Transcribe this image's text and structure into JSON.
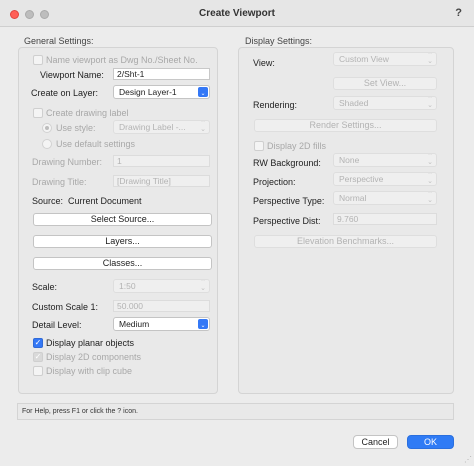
{
  "window": {
    "title": "Create Viewport",
    "help_glyph": "?"
  },
  "general": {
    "section_title": "General Settings:",
    "name_as_dwg_label": "Name viewport as Dwg No./Sheet No.",
    "viewport_name_label": "Viewport Name:",
    "viewport_name_value": "2/Sht-1",
    "create_on_layer_label": "Create on Layer:",
    "create_on_layer_value": "Design Layer-1",
    "create_drawing_label_label": "Create drawing label",
    "use_style_label": "Use style:",
    "use_style_value": "Drawing Label -...",
    "use_default_settings_label": "Use default settings",
    "drawing_number_label": "Drawing Number:",
    "drawing_number_value": "1",
    "drawing_title_label": "Drawing Title:",
    "drawing_title_value": "[Drawing Title]",
    "source_label": "Source:",
    "source_value": "Current Document",
    "select_source_button": "Select Source...",
    "layers_button": "Layers...",
    "classes_button": "Classes...",
    "scale_label": "Scale:",
    "scale_value": "1:50",
    "custom_scale_label": "Custom Scale 1:",
    "custom_scale_value": "50.000",
    "detail_level_label": "Detail Level:",
    "detail_level_value": "Medium",
    "display_planar_label": "Display planar objects",
    "display_2d_components_label": "Display 2D components",
    "display_clip_cube_label": "Display with clip cube"
  },
  "display": {
    "section_title": "Display Settings:",
    "view_label": "View:",
    "view_value": "Custom View",
    "set_view_button": "Set View...",
    "rendering_label": "Rendering:",
    "rendering_value": "Shaded",
    "render_settings_button": "Render Settings...",
    "display_2d_fills_label": "Display 2D fills",
    "rw_background_label": "RW Background:",
    "rw_background_value": "None",
    "projection_label": "Projection:",
    "projection_value": "Perspective",
    "perspective_type_label": "Perspective Type:",
    "perspective_type_value": "Normal",
    "perspective_dist_label": "Perspective Dist:",
    "perspective_dist_value": "9.760",
    "elevation_benchmarks_button": "Elevation Benchmarks..."
  },
  "footer": {
    "help_text": "For Help, press F1 or click the ? icon.",
    "cancel_button": "Cancel",
    "ok_button": "OK"
  },
  "icons": {
    "checkmark": "✓",
    "popup_arrows": "⌃⌄",
    "resize_grip": "⋰"
  },
  "colors": {
    "accent": "#3478f6",
    "window_bg": "#ececec",
    "close_dot": "#ff5f57"
  }
}
